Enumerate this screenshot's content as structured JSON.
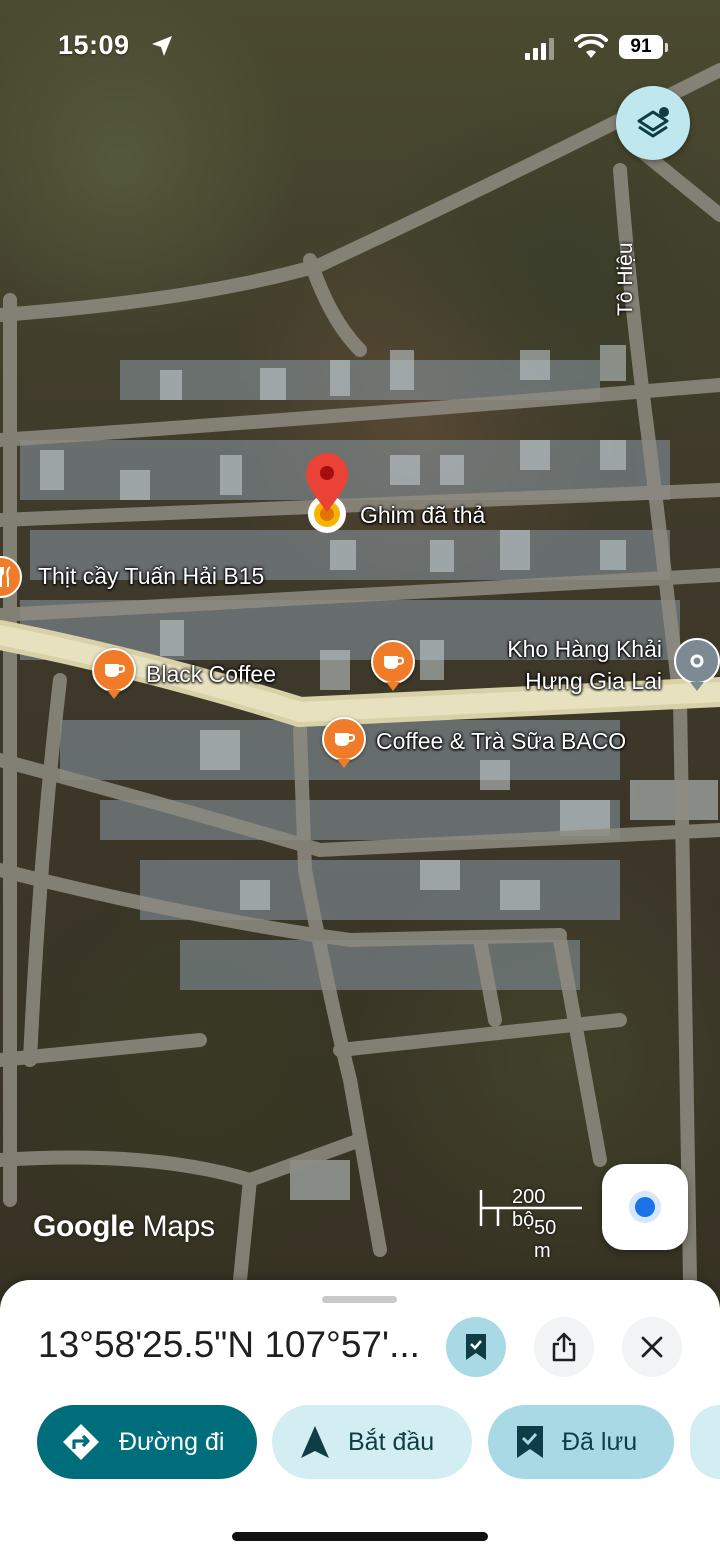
{
  "status_bar": {
    "time": "15:09",
    "battery": "91"
  },
  "map": {
    "street_label": "Tô Hiệu",
    "dropped_pin_label": "Ghim đã thả",
    "places": [
      {
        "name": "Thịt cầy Tuấn Hải B15",
        "icon": "restaurant-icon"
      },
      {
        "name": "Black Coffee",
        "icon": "coffee-icon"
      },
      {
        "name": "Coffee & Trà Sữa BACO",
        "icon": "coffee-icon"
      },
      {
        "name": "Kho Hàng Khải\nHưng Gia Lai",
        "icon": "place-icon"
      }
    ],
    "logo": {
      "part1": "Google",
      "part2": "Maps"
    },
    "scale": {
      "imperial": "200 bộ",
      "metric": "50 m"
    }
  },
  "sheet": {
    "coordinates": "13°58'25.5\"N 107°57'...",
    "actions": {
      "directions": "Đường đi",
      "start": "Bắt đầu",
      "saved": "Đã lưu"
    }
  }
}
